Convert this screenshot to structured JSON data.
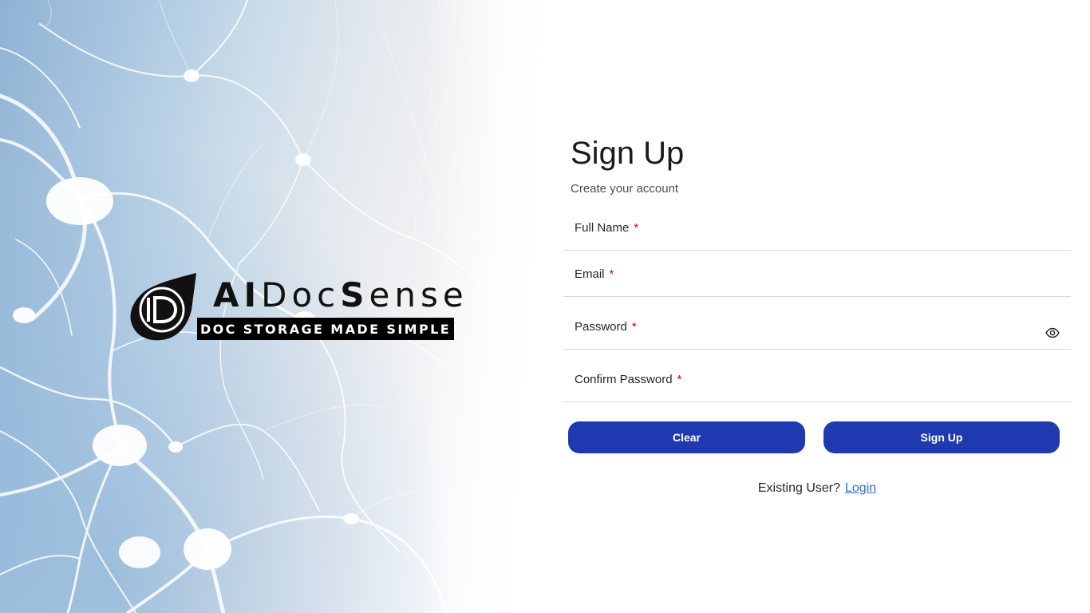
{
  "logo": {
    "word_prefix": "AI",
    "word_doc": "Doc",
    "word_s": "S",
    "word_rest": "ense",
    "tagline": "DOC STORAGE MADE SIMPLE"
  },
  "signup": {
    "title": "Sign Up",
    "subtitle": "Create your account",
    "fields": [
      {
        "label": "Full Name",
        "required_mark": "*"
      },
      {
        "label": "Email",
        "required_mark": "*"
      },
      {
        "label": "Password",
        "required_mark": "*",
        "icon": "eye-icon"
      },
      {
        "label": "Confirm Password",
        "required_mark": "*"
      }
    ],
    "clear_label": "Clear",
    "signup_label": "Sign Up",
    "existing_text": "Existing User?",
    "login_label": "Login"
  },
  "colors": {
    "button_bg": "#1f3ab0",
    "link": "#2f6fd6",
    "required": "#d0021b"
  }
}
